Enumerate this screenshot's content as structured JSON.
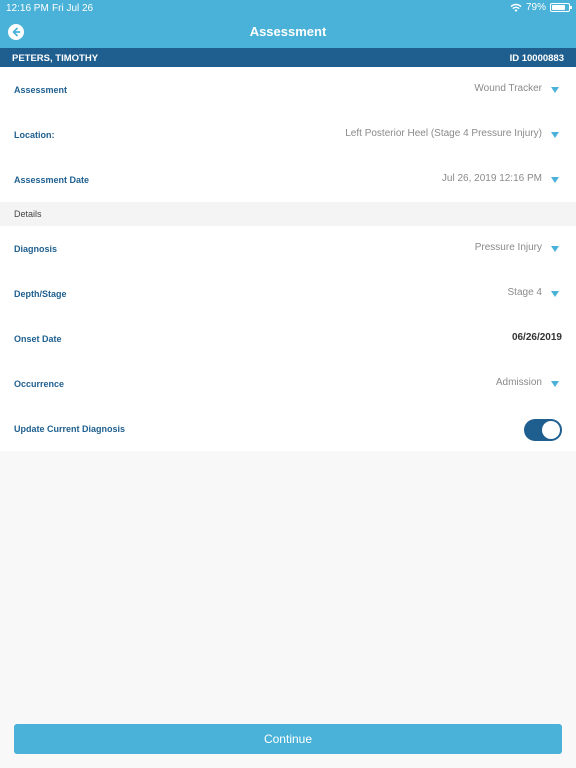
{
  "status_bar": {
    "time": "12:16 PM",
    "date": "Fri Jul 26",
    "battery_text": "79%",
    "battery_level": 0.79
  },
  "header": {
    "title": "Assessment"
  },
  "patient": {
    "name": "PETERS, TIMOTHY",
    "id": "ID 10000883"
  },
  "fields": [
    {
      "label": "Assessment",
      "value": "Wound Tracker"
    },
    {
      "label": "Location:",
      "value": "Left Posterior Heel (Stage 4 Pressure Injury)"
    },
    {
      "label": "Assessment Date",
      "value": "Jul 26, 2019 12:16 PM"
    }
  ],
  "details": {
    "section_label": "Details",
    "fields": [
      {
        "label": "Diagnosis",
        "value": "Pressure Injury"
      },
      {
        "label": "Depth/Stage",
        "value": "Stage 4"
      },
      {
        "label": "Onset Date",
        "value": "06/26/2019"
      },
      {
        "label": "Occurrence",
        "value": "Admission"
      },
      {
        "label": "Update Current Diagnosis",
        "toggle_on": true
      }
    ]
  },
  "footer": {
    "continue_label": "Continue"
  },
  "colors": {
    "accent": "#4ab2d8",
    "dark_blue": "#1f5f8f"
  }
}
